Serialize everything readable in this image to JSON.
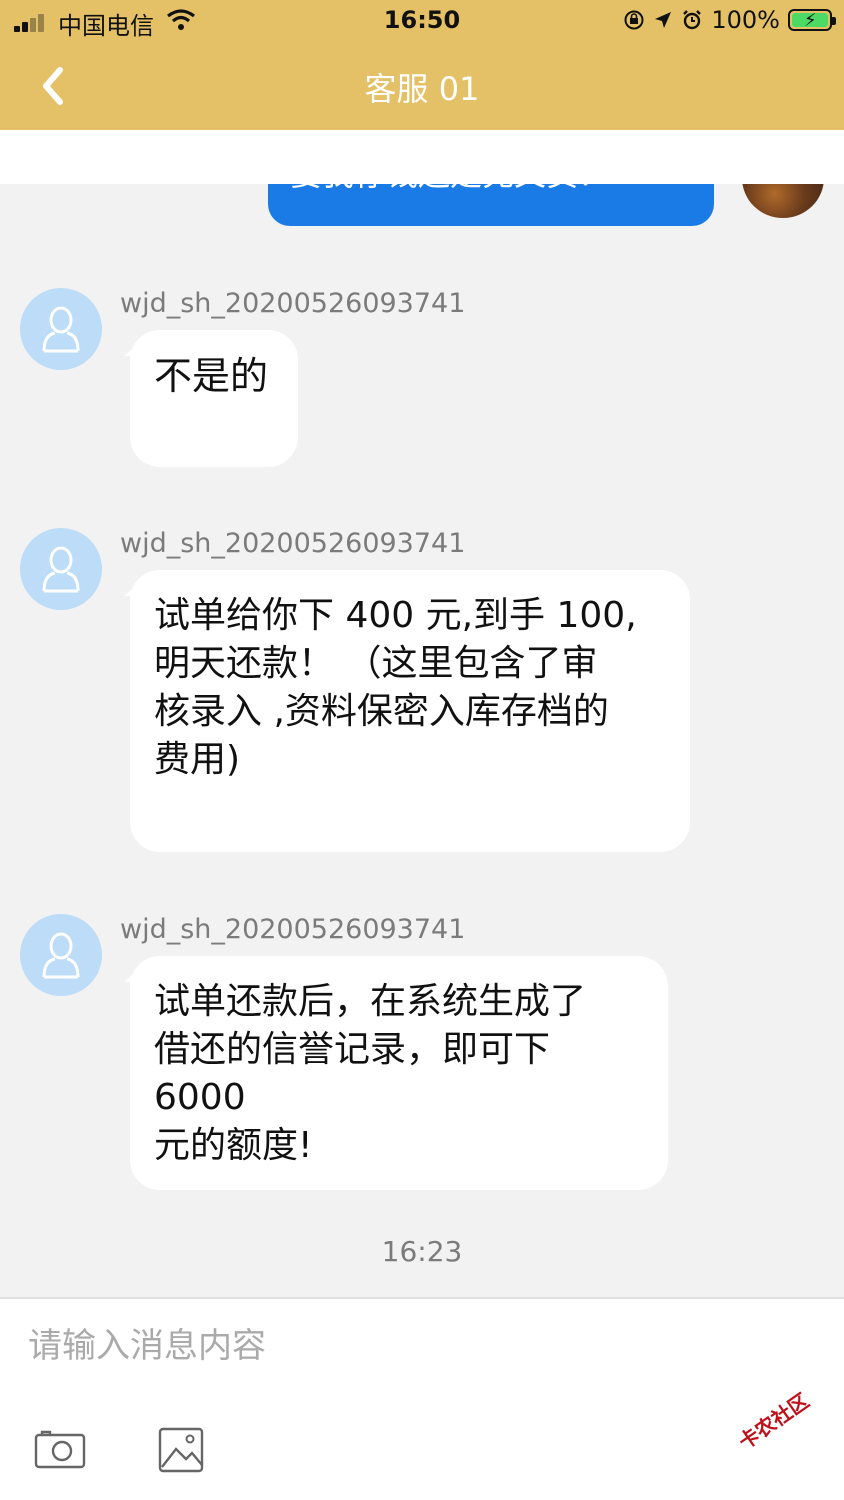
{
  "status_bar": {
    "carrier": "中国电信",
    "time": "16:50",
    "battery_percent": "100%",
    "icons": [
      "signal-icon",
      "wifi-icon",
      "orientation-lock-icon",
      "location-icon",
      "alarm-icon",
      "battery-charging-icon"
    ]
  },
  "header": {
    "title": "客服 01",
    "back_icon": "chevron-left-icon",
    "background": "#e4c066"
  },
  "messages": {
    "sent_partial": "要我存钱还是充文员？",
    "received": [
      {
        "sender": "wjd_sh_20200526093741",
        "text": "不是的"
      },
      {
        "sender": "wjd_sh_20200526093741",
        "text": "试单给你下 400 元,到手 100,\n明天还款！ （这里包含了审\n核录入 ,资料保密入库存档的\n费用)"
      },
      {
        "sender": "wjd_sh_20200526093741",
        "text": "试单还款后，在系统生成了\n借还的信誉记录，即可下\n6000\n元的额度!"
      }
    ],
    "timestamp": "16:23"
  },
  "composer": {
    "placeholder": "请输入消息内容",
    "camera_icon": "camera-icon",
    "image_icon": "image-icon"
  },
  "watermark": "卡农社区",
  "colors": {
    "sent_bubble": "#1a7ae6",
    "avatar_bg": "#bcdcf8"
  }
}
